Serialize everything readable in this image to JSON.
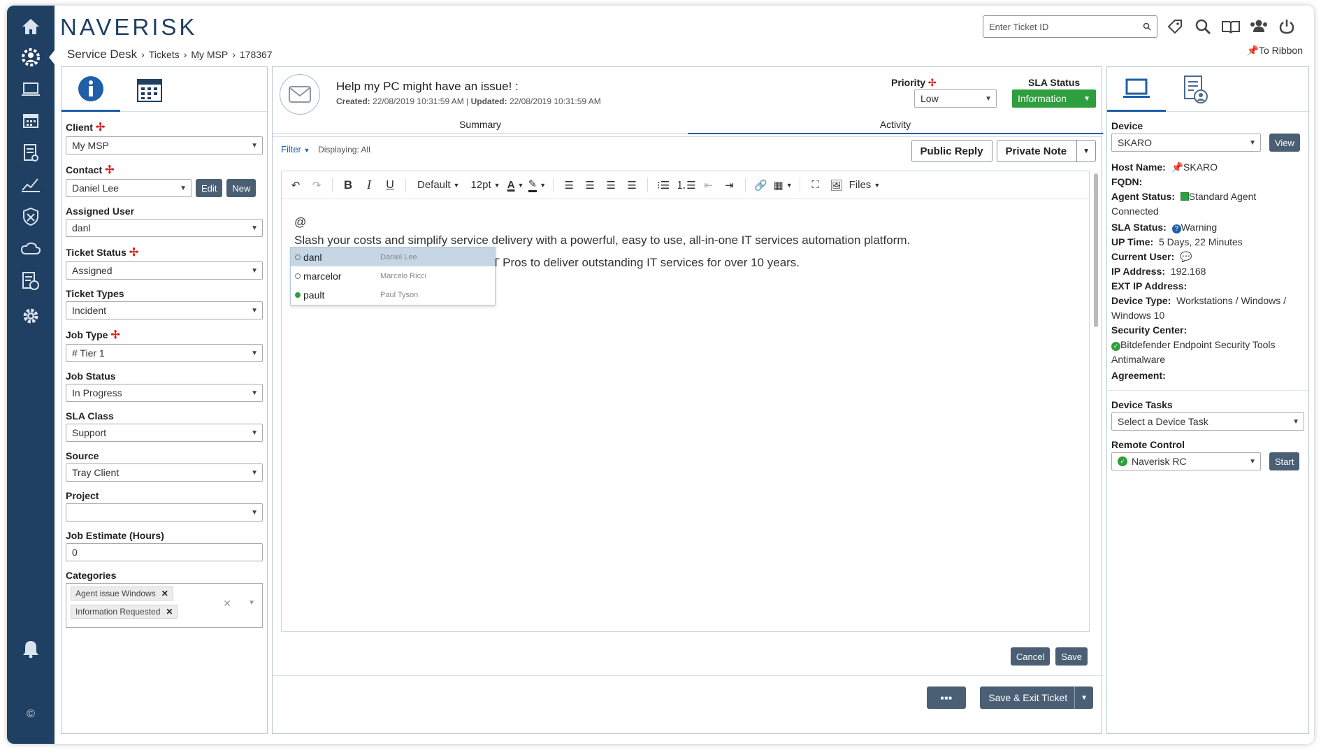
{
  "app": {
    "logo": "NAVERISK"
  },
  "breadcrumb": [
    "Service Desk",
    "Tickets",
    "My MSP",
    "178367"
  ],
  "topbar": {
    "ticket_search_placeholder": "Enter Ticket ID",
    "to_ribbon": "To Ribbon"
  },
  "nav": {
    "items": [
      "home-icon",
      "service-desk-icon",
      "devices-icon",
      "calendar-icon",
      "tasks-icon",
      "reports-icon",
      "security-icon",
      "cloud-icon",
      "documents-icon",
      "settings-icon",
      "notifications-icon",
      "copyright-icon"
    ]
  },
  "left": {
    "client": {
      "label": "Client",
      "value": "My MSP"
    },
    "contact": {
      "label": "Contact",
      "value": "Daniel Lee",
      "edit": "Edit",
      "new": "New"
    },
    "assigned_user": {
      "label": "Assigned User",
      "value": "danl"
    },
    "ticket_status": {
      "label": "Ticket Status",
      "value": "Assigned"
    },
    "ticket_types": {
      "label": "Ticket Types",
      "value": "Incident"
    },
    "job_type": {
      "label": "Job Type",
      "value": "# Tier 1"
    },
    "job_status": {
      "label": "Job Status",
      "value": "In Progress"
    },
    "sla_class": {
      "label": "SLA Class",
      "value": "Support"
    },
    "source": {
      "label": "Source",
      "value": "Tray Client"
    },
    "project": {
      "label": "Project",
      "value": ""
    },
    "job_estimate": {
      "label": "Job Estimate (Hours)",
      "value": "0"
    },
    "categories": {
      "label": "Categories",
      "tags": [
        "Agent issue Windows",
        "Information Requested"
      ]
    }
  },
  "ticket": {
    "title": "Help my PC might have an issue! :",
    "created_label": "Created:",
    "created": "22/08/2019 10:31:59 AM",
    "updated_label": "Updated:",
    "updated": "22/08/2019 10:31:59 AM",
    "priority_label": "Priority",
    "priority_value": "Low",
    "sla_label": "SLA Status",
    "sla_value": "Information",
    "tabs": [
      "Summary",
      "Activity"
    ],
    "filter": "Filter",
    "displaying": "Displaying: All",
    "public_reply": "Public Reply",
    "private_note": "Private Note"
  },
  "editor": {
    "toolbar": {
      "font": "Default",
      "size": "12pt",
      "files": "Files"
    },
    "body": {
      "mention_char": "@",
      "line1": "Slash your costs and simplify service delivery with a powerful, easy to use, all-in-one IT services automation platform.",
      "line2": "Ps & IT Pros to deliver outstanding IT services for over 10 years."
    },
    "mentions": [
      {
        "user": "danl",
        "name": "Daniel Lee"
      },
      {
        "user": "marcelor",
        "name": "Marcelo Ricci"
      },
      {
        "user": "pault",
        "name": "Paul Tyson"
      }
    ],
    "cancel": "Cancel",
    "save": "Save"
  },
  "footer": {
    "more": "■■■",
    "save_exit": "Save & Exit Ticket"
  },
  "device": {
    "label": "Device",
    "value": "SKARO",
    "view": "View",
    "host_name_label": "Host Name:",
    "host_name": "SKARO",
    "fqdn_label": "FQDN:",
    "agent_status_label": "Agent Status:",
    "agent_status": "Standard Agent Connected",
    "sla_status_label": "SLA Status:",
    "sla_status": "Warning",
    "uptime_label": "UP Time:",
    "uptime": "5 Days, 22 Minutes",
    "current_user_label": "Current User:",
    "ip_label": "IP Address:",
    "ip": "192.168",
    "ext_ip_label": "EXT IP Address:",
    "device_type_label": "Device Type:",
    "device_type": "Workstations / Windows / Windows 10",
    "security_center_label": "Security Center:",
    "security_center": "Bitdefender Endpoint Security Tools Antimalware",
    "agreement_label": "Agreement:",
    "device_tasks_label": "Device Tasks",
    "device_tasks_placeholder": "Select a Device Task",
    "remote_control_label": "Remote Control",
    "remote_control_value": "Naverisk RC",
    "start": "Start"
  },
  "colors": {
    "nav_bg": "#1f3f63",
    "accent": "#1f5fa8",
    "sla_green": "#2e9e3e",
    "button_dark": "#4a5f73"
  }
}
